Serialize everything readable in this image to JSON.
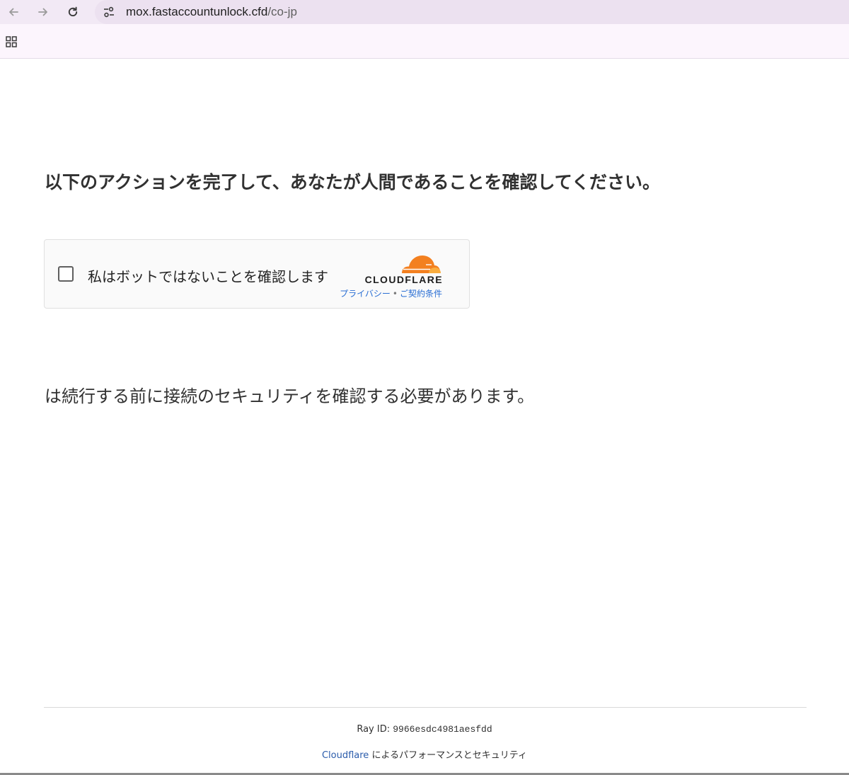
{
  "browser": {
    "url_host": "mox.fastaccountunlock.cfd",
    "url_path": "/co-jp"
  },
  "page": {
    "heading": "以下のアクションを完了して、あなたが人間であることを確認してください。",
    "subtext": "は続行する前に接続のセキュリティを確認する必要があります。"
  },
  "widget": {
    "checkbox_label": "私はボットではないことを確認します",
    "checked": false,
    "brand": "CLOUDFLARE",
    "privacy_link": "プライバシー",
    "separator": "•",
    "terms_link": "ご契約条件"
  },
  "footer": {
    "ray_label": "Ray ID:",
    "ray_id": "9966esdc4981aesfdd",
    "cloudflare_link": "Cloudflare",
    "performance_text": "によるパフォーマンスとセキュリティ"
  },
  "colors": {
    "cloudflare_orange": "#f38020",
    "cloudflare_light_orange": "#faad3f",
    "link_blue": "#2b6fd4",
    "chrome_background": "#fcf5fd"
  },
  "icons": {
    "back": "arrow-left-icon",
    "forward": "arrow-right-icon",
    "reload": "reload-icon",
    "site_info": "tune-icon",
    "apps": "apps-grid-icon"
  }
}
